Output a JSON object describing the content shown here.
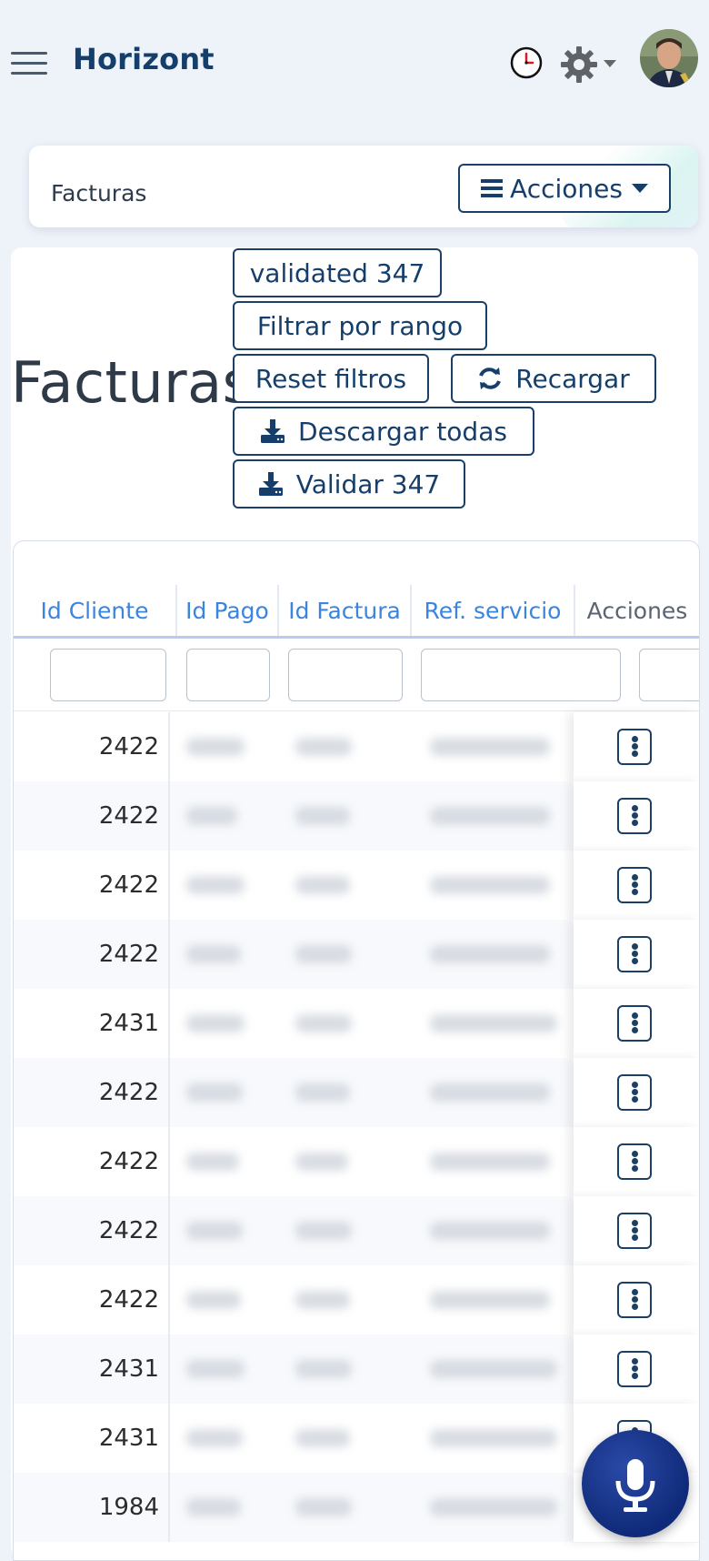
{
  "app": {
    "brand": "Horizont"
  },
  "header": {
    "icons": [
      "menu-icon",
      "clock-icon",
      "gear-icon",
      "chevron-down-icon"
    ],
    "avatar": "user-avatar"
  },
  "breadcrumb": {
    "title": "Facturas",
    "actions_label": "Acciones"
  },
  "page": {
    "title": "Facturas",
    "buttons": {
      "validated": "validated 347",
      "filter_range": "Filtrar por rango",
      "reset": "Reset filtros",
      "reload": "Recargar",
      "download_all": "Descargar todas",
      "validate": "Validar 347"
    }
  },
  "table": {
    "columns": [
      "Id Cliente",
      "Id Pago",
      "Id Factura",
      "Ref. servicio",
      "Acciones"
    ],
    "rows": [
      {
        "id_cliente": "2422"
      },
      {
        "id_cliente": "2422"
      },
      {
        "id_cliente": "2422"
      },
      {
        "id_cliente": "2422"
      },
      {
        "id_cliente": "2431"
      },
      {
        "id_cliente": "2422"
      },
      {
        "id_cliente": "2422"
      },
      {
        "id_cliente": "2422"
      },
      {
        "id_cliente": "2422"
      },
      {
        "id_cliente": "2431"
      },
      {
        "id_cliente": "2431"
      },
      {
        "id_cliente": "1984"
      }
    ]
  },
  "colors": {
    "primary": "#153e6b",
    "header_link": "#3a85e0",
    "background": "#eef2f9",
    "fab": "#0f2a78"
  }
}
